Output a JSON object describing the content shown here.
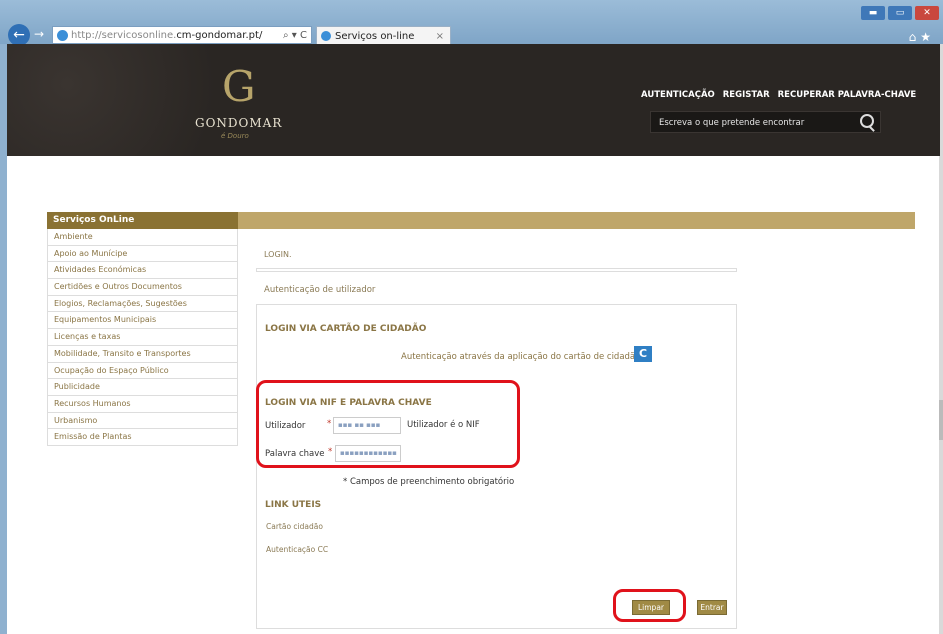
{
  "browser": {
    "address_prefix": "http://servicosonline.",
    "address_domain": "cm-gondomar.pt/",
    "address_tools": "⌕ ▾ C",
    "tab_title": "Serviços on-line",
    "tab_close": "×"
  },
  "header": {
    "logo_letter": "G",
    "logo_name": "GONDOMAR",
    "logo_sub": "é Douro",
    "nav": [
      "AUTENTICAÇÃO",
      "REGISTAR",
      "RECUPERAR PALAVRA-CHAVE"
    ],
    "search_placeholder": "Escreva o que pretende encontrar"
  },
  "sidebar": {
    "title": "Serviços OnLine",
    "items": [
      "Ambiente",
      "Apoio ao Munícipe",
      "Atividades Económicas",
      "Certidões e Outros Documentos",
      "Elogios, Reclamações, Sugestões",
      "Equipamentos Municipais",
      "Licenças e taxas",
      "Mobilidade, Transito e Transportes",
      "Ocupação do Espaço Público",
      "Publicidade",
      "Recursos Humanos",
      "Urbanismo",
      "Emissão de Plantas"
    ]
  },
  "main": {
    "breadcrumb": "LOGIN.",
    "auth_heading": "Autenticação de utilizador",
    "cc_section_title": "LOGIN VIA CARTÃO DE CIDADÃO",
    "cc_text": "Autenticação através da aplicação do cartão de cidadão",
    "nif_section_title": "LOGIN VIA NIF E PALAVRA CHAVE",
    "user_label": "Utilizador",
    "user_value": "▪▪▪ ▪▪ ▪▪▪",
    "user_hint": "Utilizador é o NIF",
    "password_label": "Palavra chave",
    "password_value": "▪▪▪▪▪▪▪▪▪▪▪▪",
    "required_mark": "*",
    "mandatory_note": "* Campos de preenchimento obrigatório",
    "links_title": "LINK UTEIS",
    "links": [
      "Cartão cidadão",
      "Autenticação CC"
    ],
    "clear_button": "Limpar",
    "enter_button": "Entrar"
  },
  "colors": {
    "gold": "#bfa66a",
    "gold_dark": "#8a7233",
    "header_bg": "#2a2623",
    "highlight": "#e0121b"
  }
}
